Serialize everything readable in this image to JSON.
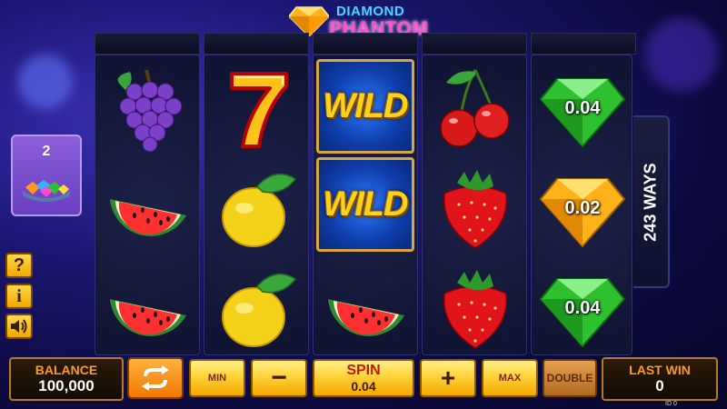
{
  "game": {
    "title_line1": "DIAMOND",
    "title_line2": "PHANTOM",
    "ways_label": "243 WAYS",
    "bonus_counter": "2"
  },
  "reels": [
    {
      "symbols": [
        "grapes",
        "watermelon",
        "watermelon"
      ]
    },
    {
      "symbols": [
        "seven",
        "lemon",
        "lemon"
      ]
    },
    {
      "symbols": [
        "wild",
        "wild",
        "watermelon"
      ],
      "wild_label": "WILD"
    },
    {
      "symbols": [
        "cherry",
        "strawberry",
        "strawberry"
      ]
    },
    {
      "symbols": [
        "green-diamond",
        "yellow-diamond",
        "green-diamond"
      ],
      "values": [
        "0.04",
        "0.02",
        "0.04"
      ]
    }
  ],
  "controls": {
    "balance_label": "BALANCE",
    "balance_value": "100,000",
    "min_label": "MIN",
    "minus_label": "−",
    "spin_label": "SPIN",
    "bet_value": "0.04",
    "plus_label": "+",
    "max_label": "MAX",
    "double_label": "DOUBLE",
    "last_win_label": "LAST WIN",
    "last_win_value": "0",
    "id_text": "ID 0"
  },
  "side_buttons": {
    "help": "?",
    "info": "i"
  },
  "colors": {
    "accent_orange": "#ff9a1f",
    "button_yellow": "#ffd23a",
    "wild_blue": "#2d7bff",
    "brand_pink": "#ff4fd0",
    "brand_cyan": "#4fd3ff"
  }
}
